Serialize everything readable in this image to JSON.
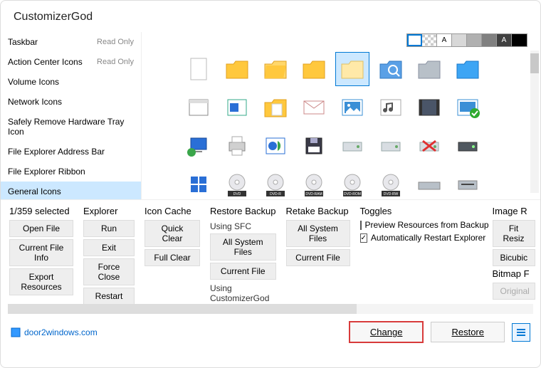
{
  "title": "CustomizerGod",
  "sidebar": {
    "read_only_label": "Read Only",
    "items": [
      {
        "label": "Taskbar",
        "readonly": true
      },
      {
        "label": "Action Center Icons",
        "readonly": true
      },
      {
        "label": "Volume Icons"
      },
      {
        "label": "Network Icons"
      },
      {
        "label": "Safely Remove Hardware Tray Icon"
      },
      {
        "label": "File Explorer Address Bar"
      },
      {
        "label": "File Explorer Ribbon"
      },
      {
        "label": "General Icons",
        "selected": true
      }
    ]
  },
  "swatch_labels": [
    "",
    "",
    "A",
    "",
    "",
    "",
    "A",
    ""
  ],
  "icons": [
    "blank-page",
    "folder-yellow",
    "folder-open-yellow",
    "folder-closed",
    "folder-empty",
    "search-folder",
    "folder-gray",
    "folder-blue",
    "window-app",
    "window-blue",
    "folder-docs",
    "mail",
    "picture",
    "music-note",
    "video",
    "checked-item",
    "computer-network",
    "printer",
    "control-panel",
    "floppy",
    "drive",
    "drive",
    "drive-red-x",
    "drive-dark",
    "start-tiles",
    "dvd",
    "dvd-r",
    "dvd-ram",
    "dvd-rom",
    "dvd-rw",
    "drive-wide",
    "drive-slot"
  ],
  "dvd_labels": [
    "",
    "DVD",
    "DVD-R",
    "DVD-RAM",
    "DVD-ROM",
    "DVD-RW",
    "",
    ""
  ],
  "selected_icon_index": 4,
  "panel": {
    "selected_count": "1/359 selected",
    "explorer_head": "Explorer",
    "iconcache_head": "Icon Cache",
    "restore_head": "Restore Backup",
    "retake_head": "Retake Backup",
    "toggles_head": "Toggles",
    "imager_head": "Image R",
    "bitmap_head": "Bitmap F",
    "open_file": "Open File",
    "current_file_info": "Current File Info",
    "export_resources": "Export Resources",
    "run": "Run",
    "exit": "Exit",
    "force_close": "Force Close",
    "restart": "Restart",
    "quick_clear": "Quick Clear",
    "full_clear": "Full Clear",
    "using_sfc": "Using SFC",
    "all_system_files": "All System Files",
    "current_file": "Current File",
    "using_cg": "Using CustomizerGod",
    "toggle_preview": "Preview Resources from Backup",
    "toggle_restart": "Automatically Restart Explorer",
    "toggle_preview_checked": false,
    "toggle_restart_checked": true,
    "fit_resize": "Fit Resiz",
    "bicubic": "Bicubic",
    "original": "Original"
  },
  "footer": {
    "link_text": "door2windows.com",
    "change": "Change",
    "restore": "Restore"
  }
}
